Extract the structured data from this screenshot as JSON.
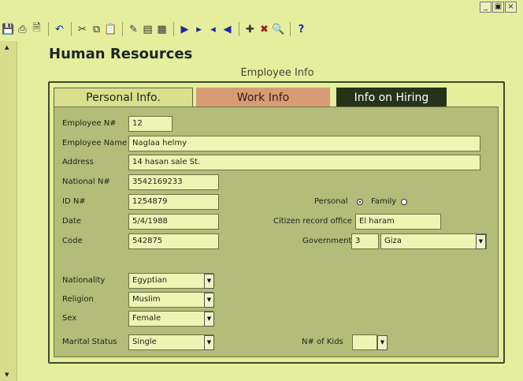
{
  "window": {
    "minimize": "_",
    "restore": "▣",
    "close": "×"
  },
  "toolbar": {
    "groups": [
      [
        "save-icon",
        "print-icon",
        "print-preview-icon"
      ],
      [
        "undo-icon"
      ],
      [
        "cut-icon",
        "copy-icon",
        "paste-icon"
      ],
      [
        "form-design-icon",
        "form-view-icon",
        "properties-icon"
      ],
      [
        "last-record-icon",
        "next-record-icon",
        "previous-record-icon",
        "first-record-icon"
      ],
      [
        "new-record-icon",
        "delete-record-icon",
        "find-icon"
      ],
      [
        "help-icon"
      ]
    ],
    "help_label": "?"
  },
  "app": {
    "title": "Human Resources",
    "subtitle": "Employee Info"
  },
  "tabs": {
    "personal": "Personal Info.",
    "work": "Work Info",
    "hiring": "Info on Hiring"
  },
  "form": {
    "employee_no": {
      "label": "Employee N#",
      "value": "12"
    },
    "employee_name": {
      "label": "Employee Name",
      "value": "Naglaa helmy"
    },
    "address": {
      "label": "Address",
      "value": "14 hasan sale  St."
    },
    "national_no": {
      "label": "National N#",
      "value": "3542169233"
    },
    "id_no": {
      "label": "ID N#",
      "value": "1254879"
    },
    "date": {
      "label": "Date",
      "value": "5/4/1988"
    },
    "code": {
      "label": "Code",
      "value": "542875"
    },
    "record_type": {
      "personal_label": "Personal",
      "family_label": "Family",
      "selected": "personal"
    },
    "citizen_office": {
      "label": "Citizen record office",
      "value": "El haram"
    },
    "government": {
      "label": "Government",
      "code": "3",
      "value": "Giza"
    },
    "nationality": {
      "label": "Nationality",
      "value": "Egyptian"
    },
    "religion": {
      "label": "Religion",
      "value": "Muslim"
    },
    "sex": {
      "label": "Sex",
      "value": "Female"
    },
    "marital_status": {
      "label": "Marital Status",
      "value": "Single"
    },
    "kids": {
      "label": "N# of Kids",
      "value": ""
    }
  },
  "colors": {
    "background": "#e4ee9c",
    "panel": "#b3bc78",
    "field": "#eef4b4",
    "tab_work": "#d89c74",
    "tab_hiring": "#26321a"
  }
}
